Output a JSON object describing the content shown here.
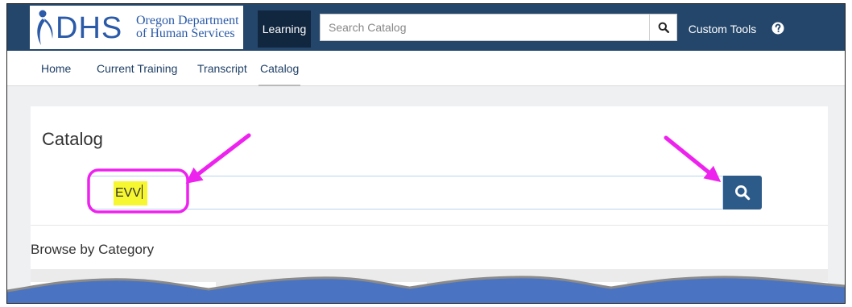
{
  "header": {
    "logo_text": "DHS",
    "logo_subtitle": "Oregon Department of Human Services",
    "nav_learning": "Learning",
    "search_placeholder": "Search Catalog",
    "nav_custom_tools": "Custom Tools",
    "help_icon": "question-circle-icon"
  },
  "subnav": {
    "items": [
      "Home",
      "Current Training",
      "Transcript",
      "Catalog"
    ],
    "active": "Catalog"
  },
  "catalog": {
    "title": "Catalog",
    "search_value": "EVV",
    "search_icon": "search-icon",
    "browse_heading": "Browse by Category"
  },
  "colors": {
    "topbar": "#24466b",
    "active_nav": "#11263f",
    "search_button": "#2d5b89",
    "highlight": "#f6f631",
    "annotation": "#ee22ee"
  }
}
